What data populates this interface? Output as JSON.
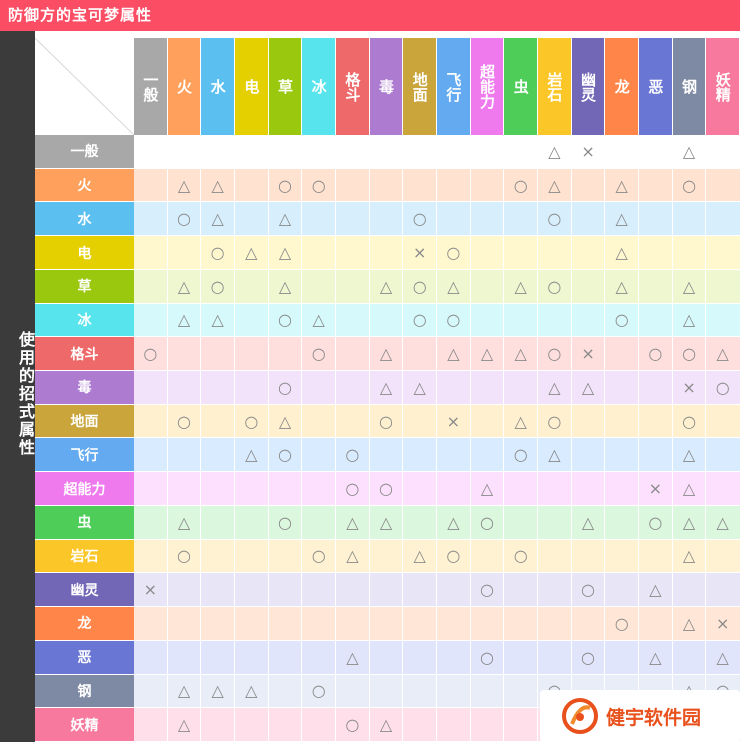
{
  "title": "防御方的宝可梦属性",
  "attacker_label": "使用的招式属性",
  "types": [
    {
      "name": "一般",
      "color": "#a8a8a8",
      "tint": "#ffffff"
    },
    {
      "name": "火",
      "color": "#ffa15c",
      "tint": "#ffe2cf"
    },
    {
      "name": "水",
      "color": "#5bbff0",
      "tint": "#d7effd"
    },
    {
      "name": "电",
      "color": "#e4cf00",
      "tint": "#fff8cf"
    },
    {
      "name": "草",
      "color": "#9ac80f",
      "tint": "#eff7d1"
    },
    {
      "name": "冰",
      "color": "#58e4ed",
      "tint": "#d6f9fb"
    },
    {
      "name": "格斗",
      "color": "#ee6a6a",
      "tint": "#ffdede"
    },
    {
      "name": "毒",
      "color": "#ad7bd0",
      "tint": "#f2e3fa"
    },
    {
      "name": "地面",
      "color": "#c9a53b",
      "tint": "#fff0cf"
    },
    {
      "name": "飞行",
      "color": "#64aaf1",
      "tint": "#d8ebff"
    },
    {
      "name": "超能力",
      "color": "#ee7aee",
      "tint": "#fde0fd"
    },
    {
      "name": "虫",
      "color": "#4ece59",
      "tint": "#dbf7de"
    },
    {
      "name": "岩石",
      "color": "#fbc728",
      "tint": "#fff2d2"
    },
    {
      "name": "幽灵",
      "color": "#7267b6",
      "tint": "#e8e5f7"
    },
    {
      "name": "龙",
      "color": "#ff8548",
      "tint": "#ffe6d7"
    },
    {
      "name": "恶",
      "color": "#6a76d4",
      "tint": "#e1e5fb"
    },
    {
      "name": "钢",
      "color": "#7e8aa3",
      "tint": "#e8edf7"
    },
    {
      "name": "妖精",
      "color": "#f7799e",
      "tint": "#ffdfe9"
    }
  ],
  "symbols": {
    "double": "○",
    "half": "△",
    "none": "×"
  },
  "matrix": [
    [
      "",
      "",
      "",
      "",
      "",
      "",
      "",
      "",
      "",
      "",
      "",
      "",
      "△",
      "×",
      "",
      "",
      "△",
      ""
    ],
    [
      "",
      "△",
      "△",
      "",
      "○",
      "○",
      "",
      "",
      "",
      "",
      "",
      "○",
      "△",
      "",
      "△",
      "",
      "○",
      ""
    ],
    [
      "",
      "○",
      "△",
      "",
      "△",
      "",
      "",
      "",
      "○",
      "",
      "",
      "",
      "○",
      "",
      "△",
      "",
      "",
      ""
    ],
    [
      "",
      "",
      "○",
      "△",
      "△",
      "",
      "",
      "",
      "×",
      "○",
      "",
      "",
      "",
      "",
      "△",
      "",
      "",
      ""
    ],
    [
      "",
      "△",
      "○",
      "",
      "△",
      "",
      "",
      "△",
      "○",
      "△",
      "",
      "△",
      "○",
      "",
      "△",
      "",
      "△",
      ""
    ],
    [
      "",
      "△",
      "△",
      "",
      "○",
      "△",
      "",
      "",
      "○",
      "○",
      "",
      "",
      "",
      "",
      "○",
      "",
      "△",
      ""
    ],
    [
      "○",
      "",
      "",
      "",
      "",
      "○",
      "",
      "△",
      "",
      "△",
      "△",
      "△",
      "○",
      "×",
      "",
      "○",
      "○",
      "△"
    ],
    [
      "",
      "",
      "",
      "",
      "○",
      "",
      "",
      "△",
      "△",
      "",
      "",
      "",
      "△",
      "△",
      "",
      "",
      "×",
      "○"
    ],
    [
      "",
      "○",
      "",
      "○",
      "△",
      "",
      "",
      "○",
      "",
      "×",
      "",
      "△",
      "○",
      "",
      "",
      "",
      "○",
      ""
    ],
    [
      "",
      "",
      "",
      "△",
      "○",
      "",
      "○",
      "",
      "",
      "",
      "",
      "○",
      "△",
      "",
      "",
      "",
      "△",
      ""
    ],
    [
      "",
      "",
      "",
      "",
      "",
      "",
      "○",
      "○",
      "",
      "",
      "△",
      "",
      "",
      "",
      "",
      "×",
      "△",
      ""
    ],
    [
      "",
      "△",
      "",
      "",
      "○",
      "",
      "△",
      "△",
      "",
      "△",
      "○",
      "",
      "",
      "△",
      "",
      "○",
      "△",
      "△"
    ],
    [
      "",
      "○",
      "",
      "",
      "",
      "○",
      "△",
      "",
      "△",
      "○",
      "",
      "○",
      "",
      "",
      "",
      "",
      "△",
      ""
    ],
    [
      "×",
      "",
      "",
      "",
      "",
      "",
      "",
      "",
      "",
      "",
      "○",
      "",
      "",
      "○",
      "",
      "△",
      "",
      ""
    ],
    [
      "",
      "",
      "",
      "",
      "",
      "",
      "",
      "",
      "",
      "",
      "",
      "",
      "",
      "",
      "○",
      "",
      "△",
      "×"
    ],
    [
      "",
      "",
      "",
      "",
      "",
      "",
      "△",
      "",
      "",
      "",
      "○",
      "",
      "",
      "○",
      "",
      "△",
      "",
      "△"
    ],
    [
      "",
      "△",
      "△",
      "△",
      "",
      "○",
      "",
      "",
      "",
      "",
      "",
      "",
      "○",
      "",
      "",
      "",
      "△",
      "○"
    ],
    [
      "",
      "△",
      "",
      "",
      "",
      "",
      "○",
      "△",
      "",
      "",
      "",
      "",
      "",
      "",
      "○",
      "○",
      "△",
      ""
    ]
  ],
  "watermark_text": "健宇软件园"
}
